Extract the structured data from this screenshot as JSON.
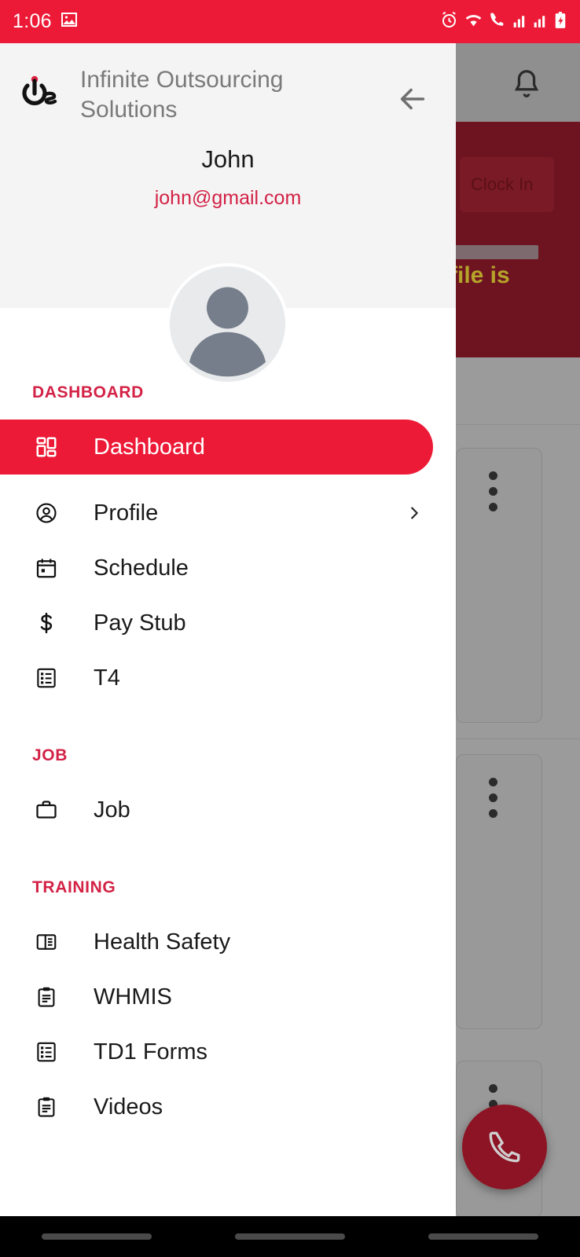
{
  "status_bar": {
    "time": "1:06",
    "left_icons": [
      "image-icon"
    ],
    "right_icons": [
      "alarm-icon",
      "wifi-icon",
      "call-wifi-icon",
      "signal-1-icon",
      "signal-2-icon",
      "battery-charging-icon"
    ],
    "background_color": "#ED1A37"
  },
  "drawer": {
    "brand": {
      "title": "Infinite Outsourcing Solutions",
      "logo_icon": "power-s-logo-icon"
    },
    "back_icon": "arrow-left-icon",
    "user": {
      "name": "John",
      "email": "john@gmail.com",
      "avatar_icon": "default-person-avatar"
    },
    "sections": [
      {
        "title": "DASHBOARD",
        "items": [
          {
            "label": "Dashboard",
            "icon": "grid-dashboard-icon",
            "active": true,
            "chevron": false
          },
          {
            "label": "Profile",
            "icon": "person-circle-icon",
            "active": false,
            "chevron": true
          },
          {
            "label": "Schedule",
            "icon": "calendar-icon",
            "active": false,
            "chevron": false
          },
          {
            "label": "Pay Stub",
            "icon": "dollar-icon",
            "active": false,
            "chevron": false
          },
          {
            "label": "T4",
            "icon": "list-document-icon",
            "active": false,
            "chevron": false
          }
        ]
      },
      {
        "title": "JOB",
        "items": [
          {
            "label": "Job",
            "icon": "briefcase-icon",
            "active": false,
            "chevron": false
          }
        ]
      },
      {
        "title": "TRAINING",
        "items": [
          {
            "label": "Health Safety",
            "icon": "article-book-icon",
            "active": false,
            "chevron": false
          },
          {
            "label": "WHMIS",
            "icon": "clipboard-icon",
            "active": false,
            "chevron": false
          },
          {
            "label": "TD1 Forms",
            "icon": "list-document-icon",
            "active": false,
            "chevron": false
          },
          {
            "label": "Videos",
            "icon": "clipboard-icon",
            "active": false,
            "chevron": false
          }
        ]
      }
    ]
  },
  "background_app": {
    "bell_icon": "notification-bell-icon",
    "clock_in_label": "Clock In",
    "hero_text": "file is",
    "fab_icon": "phone-icon",
    "card_menu_icon": "more-vertical-icon"
  },
  "colors": {
    "primary_red": "#ED1A37",
    "accent_pink": "#D32246",
    "header_gray": "#f4f4f4",
    "text_dark": "#1a1a1a",
    "text_muted": "#7a7a7a",
    "fab_red": "#8d1424",
    "hero_dark_red": "#6e1420",
    "hero_yellow": "#b5a42a"
  },
  "android_nav": {
    "buttons": [
      "back-nav-button",
      "home-nav-button",
      "recents-nav-button"
    ]
  }
}
